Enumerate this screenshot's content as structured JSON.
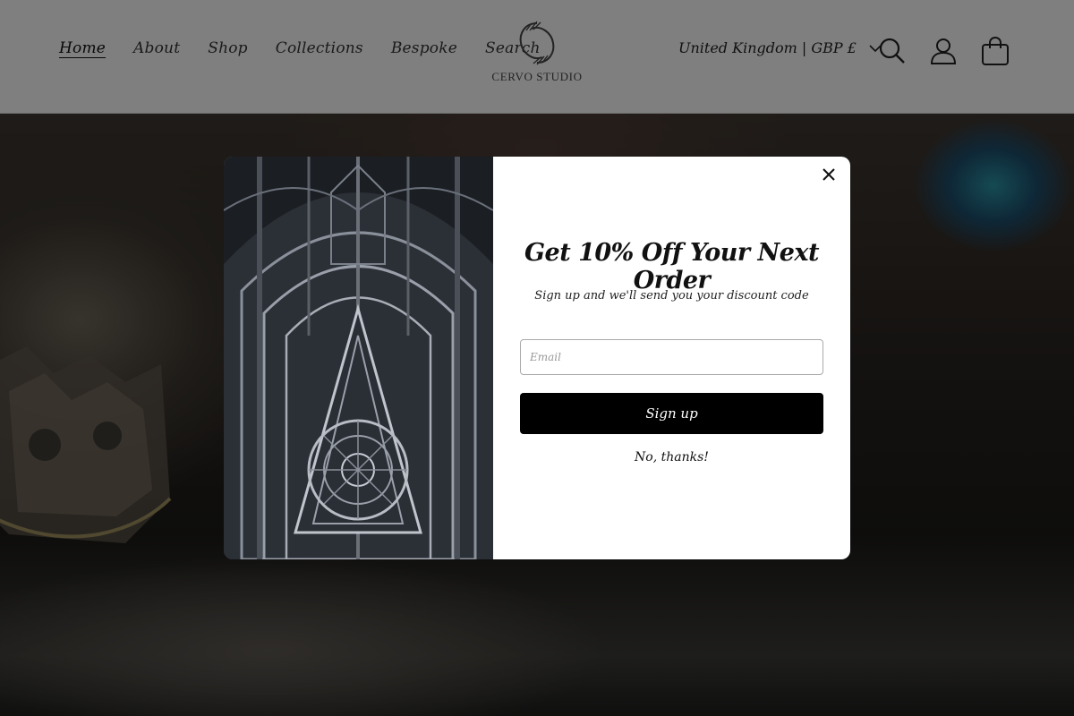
{
  "header": {
    "nav": [
      {
        "label": "Home",
        "active": true
      },
      {
        "label": "About"
      },
      {
        "label": "Shop"
      },
      {
        "label": "Collections"
      },
      {
        "label": "Bespoke"
      },
      {
        "label": "Search"
      }
    ],
    "logo_text": "CERVO STUDIO",
    "locale": "United Kingdom | GBP £",
    "icons": [
      "search-icon",
      "account-icon",
      "cart-icon"
    ]
  },
  "popup": {
    "title": "Get 10% Off Your Next Order",
    "subtitle": "Sign up and we'll send you your discount code",
    "email_placeholder": "Email",
    "email_value": "",
    "signup_label": "Sign up",
    "no_thanks_label": "No, thanks!"
  },
  "colors": {
    "popup_button": "#000000",
    "header_bg": "#f3f3f3",
    "overlay": "rgba(0,0,0,0.48)"
  }
}
